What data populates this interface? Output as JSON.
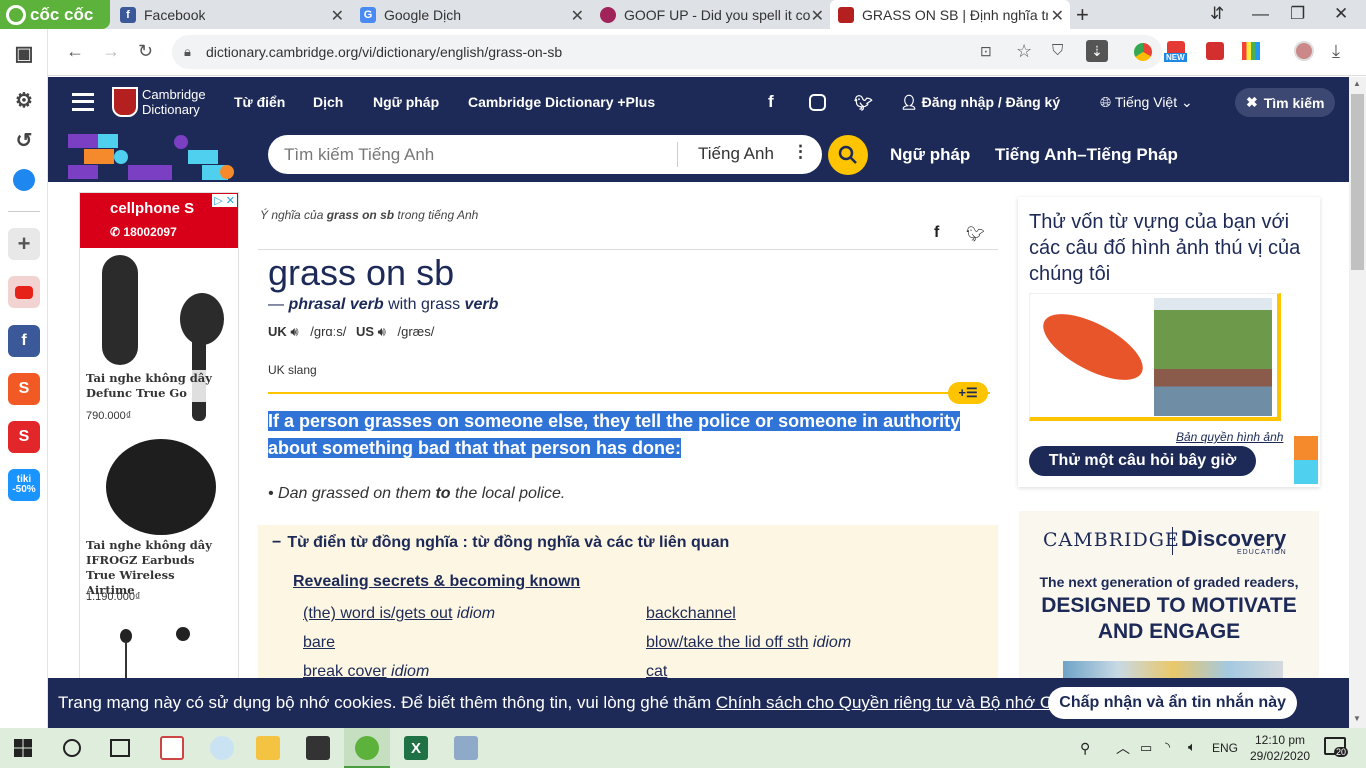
{
  "browser": {
    "brand": "cốc cốc",
    "tabs": [
      {
        "title": "Facebook",
        "icon": "facebook-icon"
      },
      {
        "title": "Google Dịch",
        "icon": "google-translate-icon"
      },
      {
        "title": "GOOF UP - Did you spell it co",
        "icon": "goofup-icon"
      },
      {
        "title": "GRASS ON SB | Định nghĩa tr",
        "icon": "cambridge-icon",
        "active": true
      }
    ],
    "new_tab": "+",
    "url": "dictionary.cambridge.org/vi/dictionary/english/grass-on-sb",
    "badge_new": "NEW"
  },
  "site": {
    "logo_line1": "Cambridge",
    "logo_line2": "Dictionary",
    "nav": [
      "Từ điển",
      "Dịch",
      "Ngữ pháp",
      "Cambridge Dictionary +Plus"
    ],
    "login": "Đăng nhập / Đăng ký",
    "language": "Tiếng Việt",
    "search_btn": "Tìm kiếm",
    "search_placeholder": "Tìm kiếm Tiếng Anh",
    "search_lang": "Tiếng Anh",
    "sub_nav": [
      "Ngữ pháp",
      "Tiếng Anh–Tiếng Pháp"
    ]
  },
  "left_ad": {
    "brand": "cellphone S",
    "phone": "18002097",
    "products": [
      {
        "name": "Tai nghe không dây Defunc True Go",
        "price": "790.000₫"
      },
      {
        "name": "Tai nghe không dây IFROGZ Earbuds True Wireless Airtime",
        "price": "1.190.000₫"
      }
    ]
  },
  "entry": {
    "breadcrumb_pre": "Ý nghĩa của ",
    "breadcrumb_word": "grass on sb",
    "breadcrumb_post": " trong tiếng Anh",
    "headword": "grass on sb",
    "pos_dash": "—",
    "pos": "phrasal verb",
    "pos_with": "with grass",
    "pos_verb": "verb",
    "uk_label": "UK",
    "uk_ipa": "/ɡrɑːs/",
    "us_label": "US",
    "us_ipa": "/ɡræs/",
    "register": "UK slang",
    "definition": "If a person grasses on someone else, they tell the police or someone in authority about something bad that that person has done:",
    "example_pre": "Dan grassed on them ",
    "example_bold": "to",
    "example_post": " the local police.",
    "thesaurus_title": "Từ điển từ đồng nghĩa : từ đồng nghĩa và các từ liên quan",
    "thesaurus_group": "Revealing secrets & becoming known",
    "thesaurus_left": [
      {
        "word": "(the) word is/gets out",
        "tag": "idiom"
      },
      {
        "word": "bare",
        "tag": ""
      },
      {
        "word": "break cover",
        "tag": "idiom"
      }
    ],
    "thesaurus_right": [
      {
        "word": "backchannel",
        "tag": ""
      },
      {
        "word": "blow/take the lid off sth",
        "tag": "idiom"
      },
      {
        "word": "cat",
        "tag": ""
      }
    ]
  },
  "quiz": {
    "text": "Thử vốn từ vựng của bạn với các câu đố hình ảnh thú vị của chúng tôi",
    "credit": "Bản quyền hình ảnh",
    "button": "Thử một câu hỏi bây giờ"
  },
  "cambridge_ad": {
    "brand1": "CAMBRIDGE",
    "brand2": "Discovery",
    "brand2_sub": "EDUCATION",
    "line1": "The next generation of graded readers,",
    "line2": "DESIGNED TO MOTIVATE",
    "line3": "AND ENGAGE"
  },
  "cookie": {
    "text": "Trang mạng này có sử dụng bộ nhớ cookies. Để biết thêm thông tin, vui lòng ghé thăm ",
    "link": "Chính sách cho Quyền riêng tư và Bộ nhớ Cookies",
    "end": ".",
    "button": "Chấp nhận và ẩn tin nhắn này"
  },
  "taskbar": {
    "lang": "ENG",
    "time": "12:10 pm",
    "date": "29/02/2020",
    "notif": "20"
  }
}
